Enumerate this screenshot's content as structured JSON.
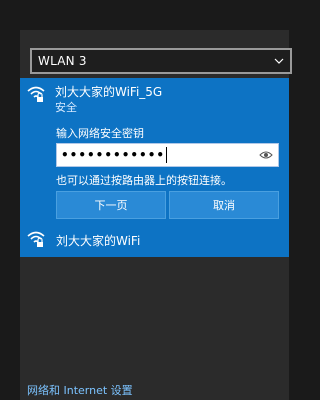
{
  "adapter": {
    "selected": "WLAN 3"
  },
  "networks": {
    "active": {
      "ssid": "刘大大家的WiFi_5G",
      "security": "安全",
      "prompt": "输入网络安全密钥",
      "password_mask": "••••••••••••",
      "hint": "也可以通过按路由器上的按钮连接。",
      "next_button": "下一页",
      "cancel_button": "取消"
    },
    "other": {
      "ssid": "刘大大家的WiFi"
    }
  },
  "footer": {
    "settings_link": "网络和 Internet 设置"
  },
  "colors": {
    "accent": "#0d73c4",
    "panel": "#2b2b2b",
    "link": "#7cc3ff"
  }
}
